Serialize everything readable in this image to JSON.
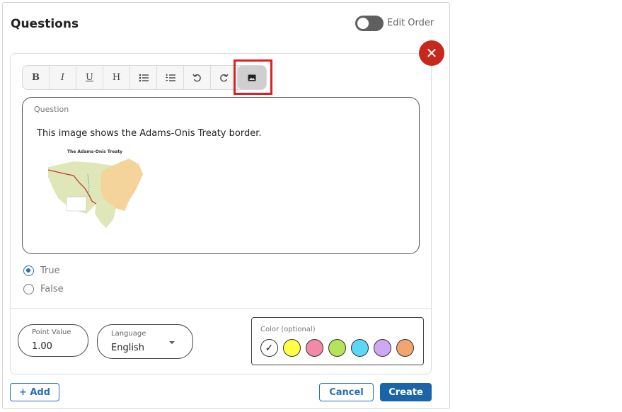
{
  "header": {
    "title": "Questions",
    "edit_order_label": "Edit Order",
    "edit_order_on": false
  },
  "toolbar": {
    "buttons": [
      {
        "name": "bold",
        "label": "B"
      },
      {
        "name": "italic",
        "label": "I"
      },
      {
        "name": "underline",
        "label": "U"
      },
      {
        "name": "heading",
        "label": "H"
      },
      {
        "name": "bullet-list",
        "label": "bullet-list-icon"
      },
      {
        "name": "numbered-list",
        "label": "numbered-list-icon"
      },
      {
        "name": "undo",
        "label": "undo-icon"
      },
      {
        "name": "redo",
        "label": "redo-icon"
      },
      {
        "name": "image",
        "label": "image-icon"
      }
    ]
  },
  "question": {
    "label": "Question",
    "text": "This image shows the Adams-Onis Treaty border.",
    "image_title": "The Adams-Onis Treaty"
  },
  "answers": [
    {
      "label": "True",
      "selected": true
    },
    {
      "label": "False",
      "selected": false
    }
  ],
  "point_value": {
    "label": "Point Value",
    "value": "1.00"
  },
  "language": {
    "label": "Language",
    "value": "English"
  },
  "color": {
    "label": "Color (optional)",
    "swatches": [
      "#ffffff",
      "#ffff44",
      "#f08aa6",
      "#b6e35a",
      "#5cd8f6",
      "#cfa7f2",
      "#f2a56e"
    ],
    "selected_index": 0
  },
  "footer": {
    "add_label": "+ Add",
    "cancel_label": "Cancel",
    "create_label": "Create"
  },
  "colors": {
    "accent": "#1c64a8",
    "close": "#c7281e",
    "highlight": "#e02020"
  }
}
